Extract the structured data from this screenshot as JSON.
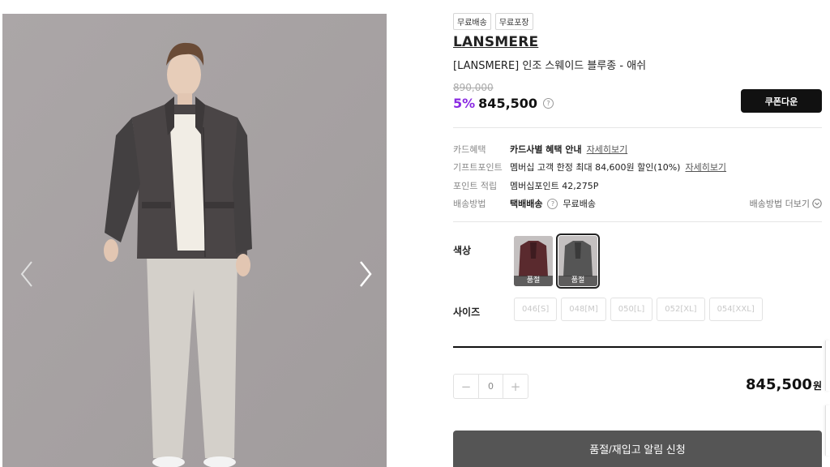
{
  "gallery": {
    "image_name": "model-wearing-jacket",
    "prev_icon": "chevron-left-icon",
    "next_icon": "chevron-right-icon"
  },
  "badges": [
    "무료배송",
    "무료포장"
  ],
  "product": {
    "brand": "LANSMERE",
    "name": "[LANSMERE] 인조 스웨이드 블루종 - 애쉬",
    "original_price": "890,000",
    "discount": "5%",
    "price": "845,500",
    "price_info_icon": "?"
  },
  "coupon_button": "쿠폰다운",
  "info": {
    "card": {
      "label": "카드혜택",
      "value": "카드사별 혜택 안내",
      "link": "자세히보기"
    },
    "gift": {
      "label": "기프트포인트",
      "value": "멤버십 고객 한정 최대 84,600원 할인(10%)",
      "link": "자세히보기"
    },
    "points": {
      "label": "포인트 적립",
      "value": "멤버십포인트 42,275P"
    },
    "shipping": {
      "label": "배송방법",
      "method": "택배배송",
      "icon": "?",
      "fee": "무료배송",
      "more": "배송방법 더보기"
    }
  },
  "color": {
    "label": "색상",
    "options": [
      {
        "name": "burgundy",
        "swatch_color": "#5a2a2e",
        "soldout": "품절"
      },
      {
        "name": "ash",
        "swatch_color": "#555555",
        "soldout": "품절"
      }
    ]
  },
  "size": {
    "label": "사이즈",
    "options": [
      "046[S]",
      "048[M]",
      "050[L]",
      "052[XL]",
      "054[XXL]"
    ]
  },
  "quantity": {
    "minus": "−",
    "value": "0",
    "plus": "+"
  },
  "total": {
    "amount": "845,500",
    "unit": "원"
  },
  "restock_button": "품절/재입고 알림 신청",
  "colors": {
    "accent_purple": "#8a2be2",
    "button_dark": "#111111",
    "restock_gray": "#555555"
  }
}
